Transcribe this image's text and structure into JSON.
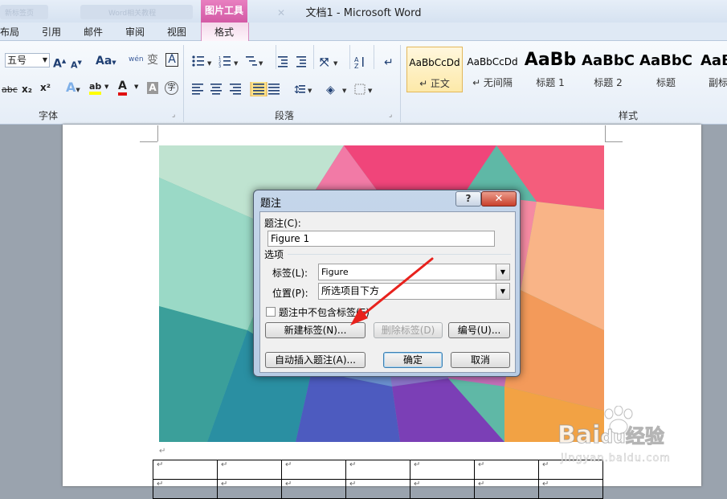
{
  "window": {
    "title": "文档1 - Microsoft Word",
    "ghost_tab_1": "新标签页",
    "ghost_tab_2": "Word相关教程"
  },
  "ribbon_tabs": {
    "contextual_group": "图片工具",
    "tabs": [
      "布局",
      "引用",
      "邮件",
      "审阅",
      "视图",
      "格式"
    ]
  },
  "font_group": {
    "label": "字体",
    "font_size": "五号",
    "grow_icon_text": "A",
    "shrink_icon_text": "A",
    "case_text": "Aa",
    "pinyin_text": "wén",
    "phonetic_text": "变",
    "border_char_text": "A",
    "strike_text": "abc",
    "sub_text": "x₂",
    "sup_text": "x²",
    "effects_text": "A",
    "highlight_text": "ab",
    "font_color_text": "A",
    "shading_text": "A",
    "enclose_text": "字"
  },
  "paragraph_group": {
    "label": "段落"
  },
  "styles_group": {
    "label": "样式",
    "items": [
      {
        "sample": "AaBbCcDd",
        "name": "↵ 正文",
        "active": true
      },
      {
        "sample": "AaBbCcDd",
        "name": "↵ 无间隔"
      },
      {
        "sample": "AaBb",
        "name": "标题 1"
      },
      {
        "sample": "AaBbC",
        "name": "标题 2"
      },
      {
        "sample": "AaBbC",
        "name": "标题"
      },
      {
        "sample": "AaB",
        "name": "副标"
      }
    ]
  },
  "dialog": {
    "title": "题注",
    "help": "?",
    "close": "✕",
    "caption_label": "题注(C):",
    "caption_value": "Figure 1",
    "options_heading": "选项",
    "label_label": "标签(L):",
    "label_value": "Figure",
    "position_label": "位置(P):",
    "position_value": "所选项目下方",
    "exclude_label": "题注中不包含标签(E)",
    "new_label_button": "新建标签(N)...",
    "delete_label_button": "删除标签(D)",
    "numbering_button": "编号(U)...",
    "autocaption_button": "自动插入题注(A)...",
    "ok_button": "确定",
    "cancel_button": "取消"
  },
  "document": {
    "para_mark": "↵"
  },
  "watermark": {
    "brand": "Bai",
    "brand2": "du",
    "cn": "经验",
    "url": "jingyan.baidu.com"
  },
  "colors": {
    "accent_pink": "#d35aa5",
    "arrow_red": "#e8221d",
    "dialog_frame": "#b7cbe4"
  }
}
